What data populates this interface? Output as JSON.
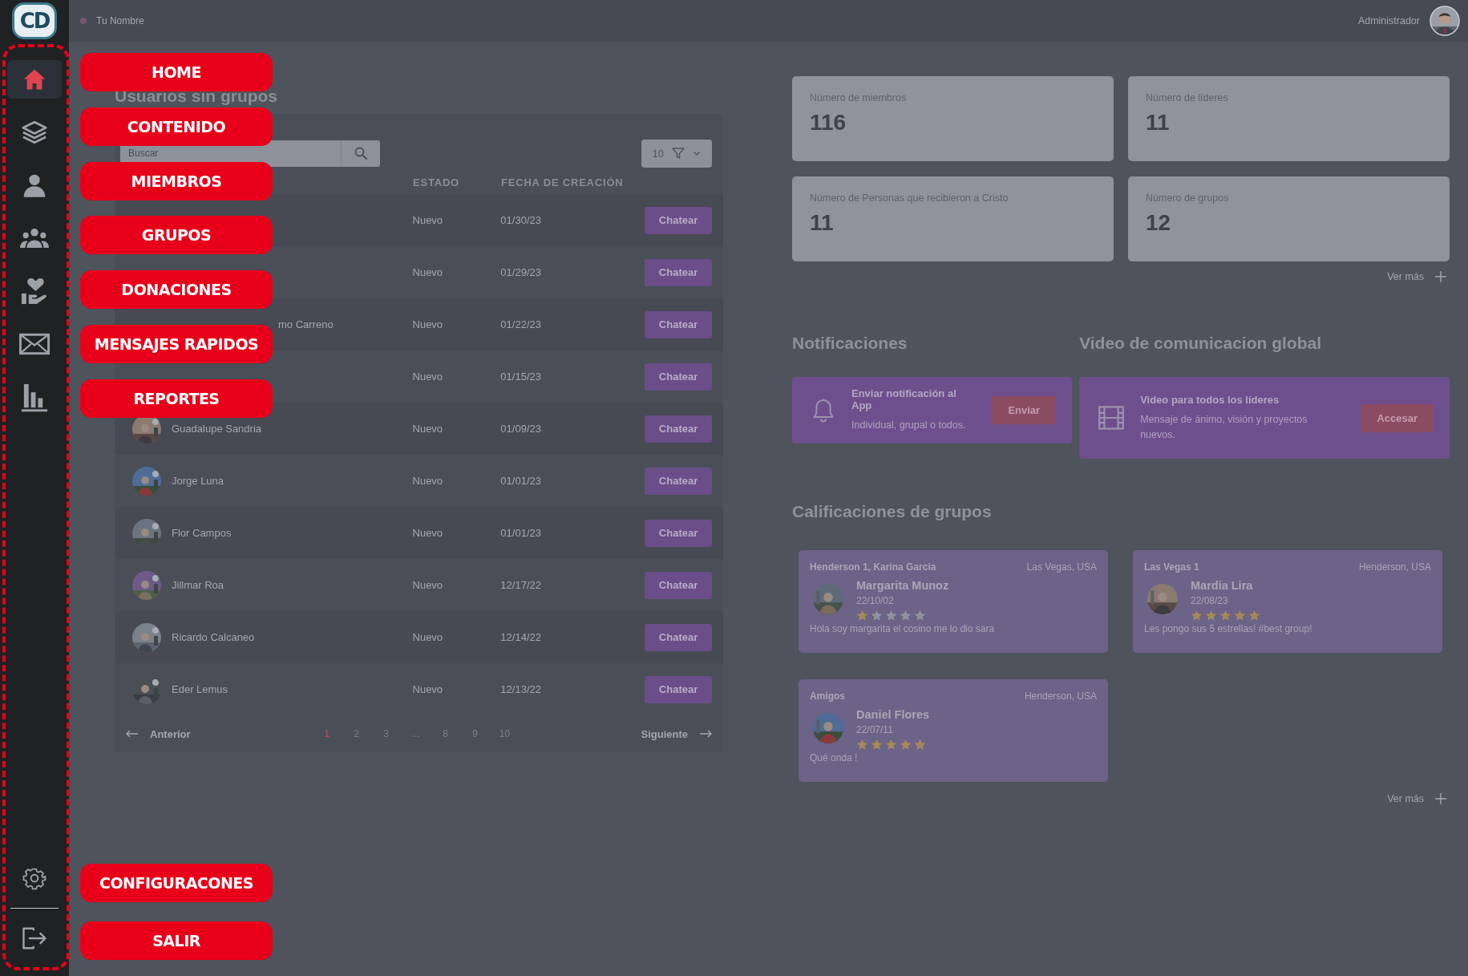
{
  "sidebar": {
    "logo": "CD",
    "items": [
      {
        "kind": "home",
        "selected": true
      },
      {
        "kind": "layers",
        "selected": false
      },
      {
        "kind": "user",
        "selected": false
      },
      {
        "kind": "users",
        "selected": false
      },
      {
        "kind": "donate",
        "selected": false
      },
      {
        "kind": "mail",
        "selected": false
      },
      {
        "kind": "chart",
        "selected": false
      }
    ],
    "bottom_items": [
      {
        "kind": "gear"
      },
      {
        "kind": "logout"
      }
    ]
  },
  "topbar": {
    "title": "Tu Nombre",
    "user": "Administrador"
  },
  "users_panel": {
    "title": "Usuarios sin grupos",
    "search": {
      "placeholder": "Buscar"
    },
    "page_size": "10",
    "columns": [
      "ESTADO",
      "FECHA DE CREACIÓN"
    ],
    "rows": [
      {
        "status": "Nuevo",
        "date": "01/30/23",
        "action": "Chatear"
      },
      {
        "status": "Nuevo",
        "date": "01/29/23",
        "action": "Chatear"
      },
      {
        "name": "mo Carreno",
        "covered": true,
        "status": "Nuevo",
        "date": "01/22/23",
        "action": "Chatear"
      },
      {
        "status": "Nuevo",
        "date": "01/15/23",
        "action": "Chatear"
      },
      {
        "name": "Guadalupe Sandria",
        "status": "Nuevo",
        "date": "01/09/23",
        "action": "Chatear"
      },
      {
        "name": "Jorge Luna",
        "status": "Nuevo",
        "date": "01/01/23",
        "action": "Chatear"
      },
      {
        "name": "Flor Campos",
        "status": "Nuevo",
        "date": "01/01/23",
        "action": "Chatear"
      },
      {
        "name": "Jillmar Roa",
        "status": "Nuevo",
        "date": "12/17/22",
        "action": "Chatear"
      },
      {
        "name": "Ricardo Calcaneo",
        "status": "Nuevo",
        "date": "12/14/22",
        "action": "Chatear"
      },
      {
        "name": "Eder Lemus",
        "status": "Nuevo",
        "date": "12/13/22",
        "action": "Chatear"
      }
    ],
    "pagination": {
      "previous": "Anterior",
      "next": "Siguiente",
      "pages": [
        {
          "label": "1",
          "selected": true
        },
        {
          "label": "2",
          "selected": false
        },
        {
          "label": "3",
          "selected": false
        },
        {
          "label": "...",
          "selected": false
        },
        {
          "label": "8",
          "selected": false
        },
        {
          "label": "9",
          "selected": false
        },
        {
          "label": "10",
          "selected": false
        }
      ]
    }
  },
  "stats": [
    {
      "label": "Número de miembros",
      "value": "116"
    },
    {
      "label": "Número de líderes",
      "value": "11"
    },
    {
      "label": "Número de Personas que recibieron a Cristo",
      "value": "11"
    },
    {
      "label": "Número de grupos",
      "value": "12"
    }
  ],
  "stats_more": "Ver más",
  "notifications": {
    "title": "Notificaciones",
    "heading": "Enviar notificación al App",
    "text": "Individual, grupal o todos.",
    "button": "Enviar"
  },
  "video": {
    "title": "Video de comunicacion global",
    "heading": "Video para todos los líderes",
    "text": "Mensaje de ánimo, visión y proyectos nuevos.",
    "button": "Accesar"
  },
  "ratings": {
    "title": "Calificaciones de grupos",
    "more": "Ver más",
    "items": [
      {
        "group": "Henderson 1, Karina Garcia",
        "location": "Las Vegas, USA",
        "name": "Margarita Munoz",
        "date": "22/10/02",
        "stars": 1,
        "comment": "Hola soy margarita el cosino me lo dio sara"
      },
      {
        "group": "Las Vegas 1",
        "location": "Henderson, USA",
        "name": "Mardia Lira",
        "date": "22/08/23",
        "stars": 5,
        "comment": "Les pongo sus 5 estrellas! #best group!"
      },
      {
        "group": "Amigos",
        "location": "Henderson, USA",
        "name": "Daniel Flores",
        "date": "22/07/11",
        "stars": 5,
        "comment": "Qué onda !"
      }
    ]
  },
  "callouts": [
    {
      "label": "HOME"
    },
    {
      "label": "CONTENIDO"
    },
    {
      "label": "MIEMBROS"
    },
    {
      "label": "GRUPOS"
    },
    {
      "label": "DONACIONES"
    },
    {
      "label": "MENSAJES RAPIDOS"
    },
    {
      "label": "REPORTES"
    },
    {
      "label": "CONFIGURACONES"
    },
    {
      "label": "SALIR"
    }
  ]
}
